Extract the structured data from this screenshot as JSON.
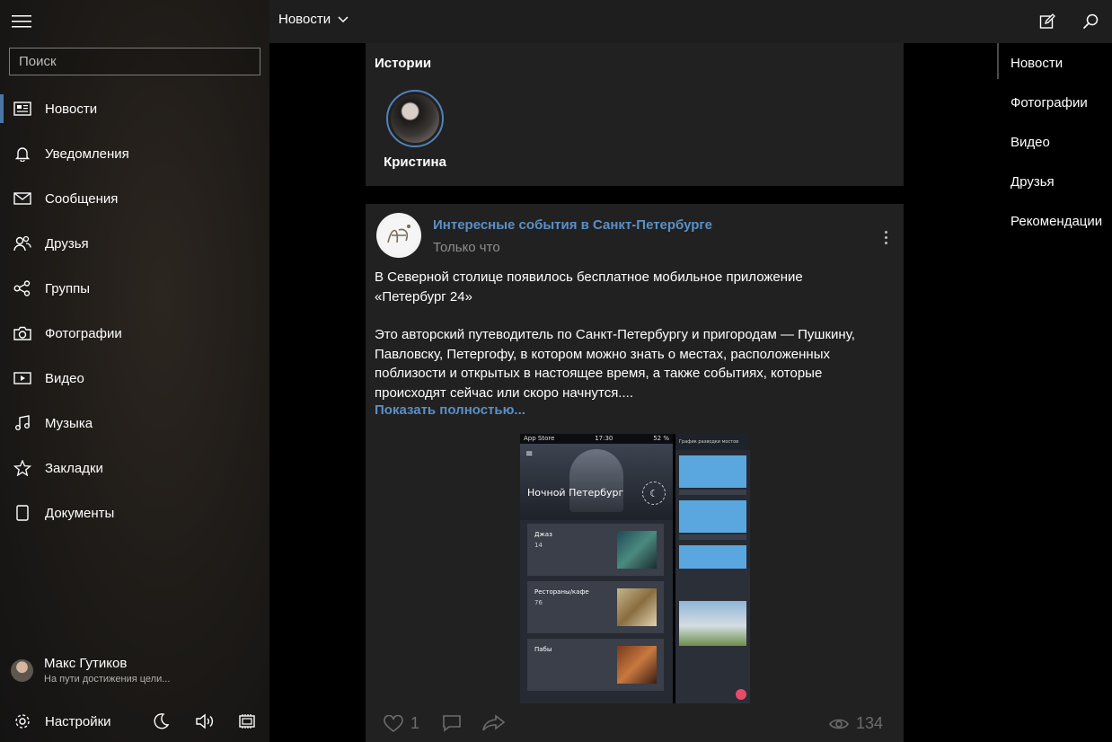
{
  "sidebar": {
    "search_placeholder": "Поиск",
    "items": [
      {
        "label": "Новости",
        "icon": "news-icon",
        "active": true
      },
      {
        "label": "Уведомления",
        "icon": "bell-icon"
      },
      {
        "label": "Сообщения",
        "icon": "mail-icon"
      },
      {
        "label": "Друзья",
        "icon": "friends-icon"
      },
      {
        "label": "Группы",
        "icon": "groups-icon"
      },
      {
        "label": "Фотографии",
        "icon": "camera-icon"
      },
      {
        "label": "Видео",
        "icon": "video-icon"
      },
      {
        "label": "Музыка",
        "icon": "music-icon"
      },
      {
        "label": "Закладки",
        "icon": "star-icon"
      },
      {
        "label": "Документы",
        "icon": "document-icon"
      }
    ],
    "user": {
      "name": "Макс Гутиков",
      "status": "На пути достижения цели..."
    },
    "settings_label": "Настройки"
  },
  "topbar": {
    "feed_title": "Новости"
  },
  "stories": {
    "title": "Истории",
    "items": [
      {
        "name": "Кристина"
      }
    ]
  },
  "post": {
    "author": "Интересные события в Санкт-Петербурге",
    "time": "Только что",
    "paragraph1": "В Северной столице появилось бесплатное мобильное приложение\n«Петербург 24»",
    "paragraph2": "Это авторский путеводитель по Санкт-Петербургу и пригородам — Пушкину,\nПавловску, Петергофу, в котором можно знать о местах, расположенных\nпоблизости и открытых в настоящее время, а также событиях, которые\nпроисходят сейчас или скоро начнутся....",
    "show_more": "Показать полностью...",
    "image": {
      "status_left": "App Store",
      "status_time": "17:30",
      "status_battery": "52 %",
      "hero_title": "Ночной Петербург",
      "cards": [
        {
          "title": "Джаз",
          "count": "14"
        },
        {
          "title": "Рестораны/кафе",
          "count": "76"
        },
        {
          "title": "Пабы",
          "count": ""
        }
      ],
      "right_header": "График разводки мостов"
    },
    "likes": "1",
    "views": "134"
  },
  "right_pivot": {
    "items": [
      {
        "label": "Новости",
        "active": true
      },
      {
        "label": "Фотографии"
      },
      {
        "label": "Видео"
      },
      {
        "label": "Друзья"
      },
      {
        "label": "Рекомендации"
      }
    ]
  },
  "colors": {
    "accent": "#4a76a8",
    "link": "#5b8fc7",
    "card_bg": "#212121",
    "topbar_bg": "#1e1e1e"
  }
}
